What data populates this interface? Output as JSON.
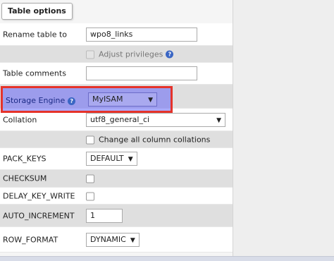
{
  "legend": "Table options",
  "rename": {
    "label": "Rename table to",
    "value": "wpo8_links"
  },
  "adjust_privileges": {
    "label": "Adjust privileges"
  },
  "table_comments": {
    "label": "Table comments",
    "value": ""
  },
  "storage_engine": {
    "label": "Storage Engine",
    "value": "MyISAM"
  },
  "collation": {
    "label": "Collation",
    "value": "utf8_general_ci"
  },
  "change_collations": {
    "label": "Change all column collations"
  },
  "pack_keys": {
    "label": "PACK_KEYS",
    "value": "DEFAULT"
  },
  "checksum": {
    "label": "CHECKSUM"
  },
  "delay_key_write": {
    "label": "DELAY_KEY_WRITE"
  },
  "auto_increment": {
    "label": "AUTO_INCREMENT",
    "value": "1"
  },
  "row_format": {
    "label": "ROW_FORMAT",
    "value": "DYNAMIC"
  },
  "icons": {
    "help": "help-icon",
    "dropdown": "chevron-down-icon"
  },
  "colors": {
    "highlight_border": "#e5332a",
    "highlight_fill": "#6464f5",
    "help_icon": "#3a66c4"
  }
}
